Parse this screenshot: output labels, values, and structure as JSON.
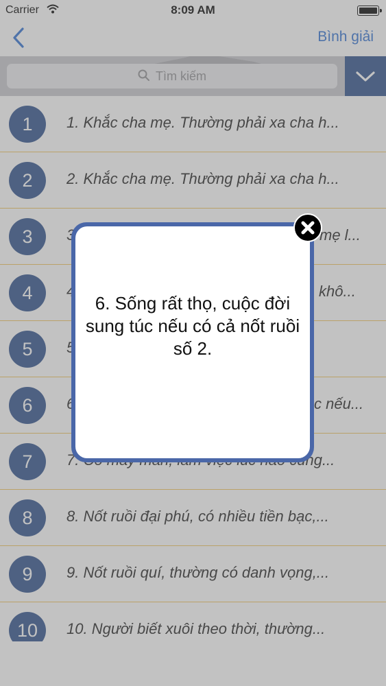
{
  "status_bar": {
    "carrier": "Carrier",
    "time": "8:09 AM"
  },
  "navbar": {
    "back_icon": "chevron-left-icon",
    "right_button": "Bình giải"
  },
  "search": {
    "placeholder": "Tìm kiếm",
    "dropdown_icon": "chevron-down-icon"
  },
  "list": {
    "items": [
      {
        "num": "1",
        "text": "1. Khắc cha mẹ. Thường phải xa cha h..."
      },
      {
        "num": "2",
        "text": "2. Khắc cha mẹ. Thường phải xa cha h..."
      },
      {
        "num": "3",
        "text": "3"
      },
      {
        "num": "4",
        "text": "4"
      },
      {
        "num": "5",
        "text": "5"
      },
      {
        "num": "6",
        "text": "6"
      },
      {
        "num": "7",
        "text": "7. Có may mắn, làm việc lúc nào cũng..."
      },
      {
        "num": "8",
        "text": "8. Nốt ruồi đại phú, có nhiều tiền bạc,..."
      },
      {
        "num": "9",
        "text": "9. Nốt ruồi quí, thường có danh vọng,..."
      },
      {
        "num": "10",
        "text": "10. Người biết xuôi theo thời, thường..."
      }
    ],
    "partial_tails": {
      "row3": "mẹ l...",
      "row4": "khô...",
      "row6": "c nếu..."
    }
  },
  "popup": {
    "message": "6. Sống rất thọ, cuộc đời sung túc nếu có cả nốt ruồi số 2.",
    "close_icon": "close-icon"
  },
  "colors": {
    "accent_blue": "#2f6fd1",
    "badge_navy": "#2d4f8a",
    "divider_gold": "#f0c35b",
    "popup_border": "#4a67a8"
  }
}
